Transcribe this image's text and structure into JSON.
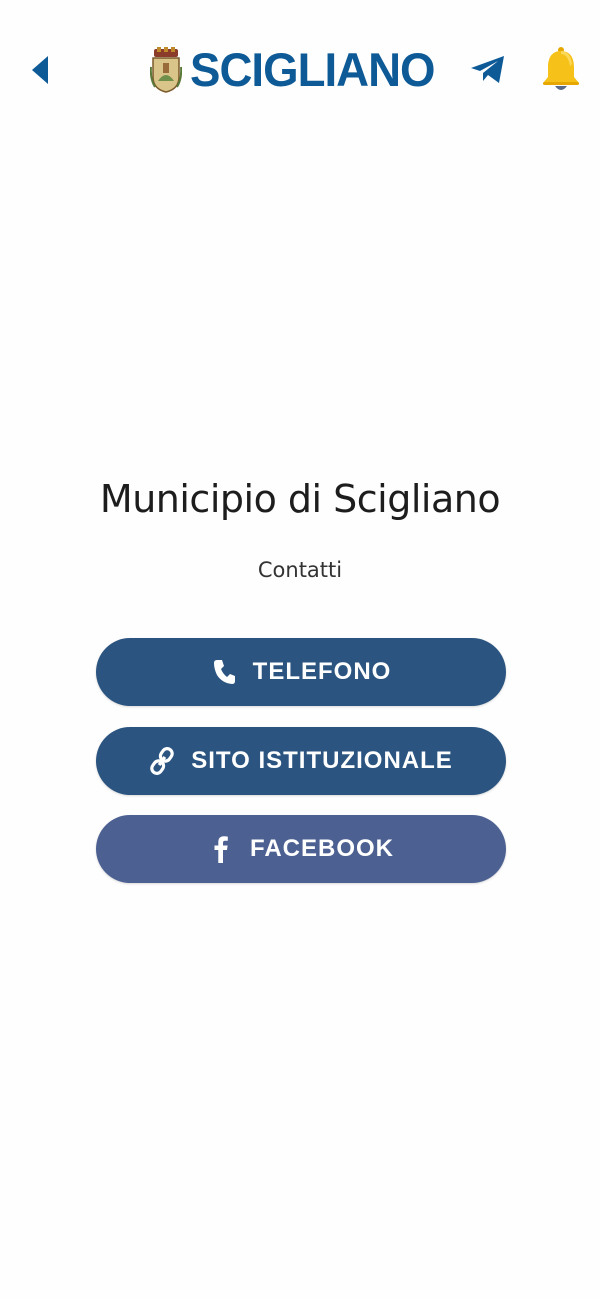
{
  "header": {
    "brand_title": "SCIGLIANO",
    "brand_color": "#0d5a97",
    "back_icon": "back-arrow-icon",
    "telegram_icon": "telegram-icon",
    "bell_icon": "bell-icon"
  },
  "main": {
    "title": "Municipio di Scigliano",
    "subtitle": "Contatti",
    "buttons": [
      {
        "label": "TELEFONO",
        "icon": "phone-icon",
        "color": "#2b5580"
      },
      {
        "label": "SITO ISTITUZIONALE",
        "icon": "link-icon",
        "color": "#2b5580"
      },
      {
        "label": "FACEBOOK",
        "icon": "facebook-icon",
        "color": "#4c6092"
      }
    ]
  }
}
